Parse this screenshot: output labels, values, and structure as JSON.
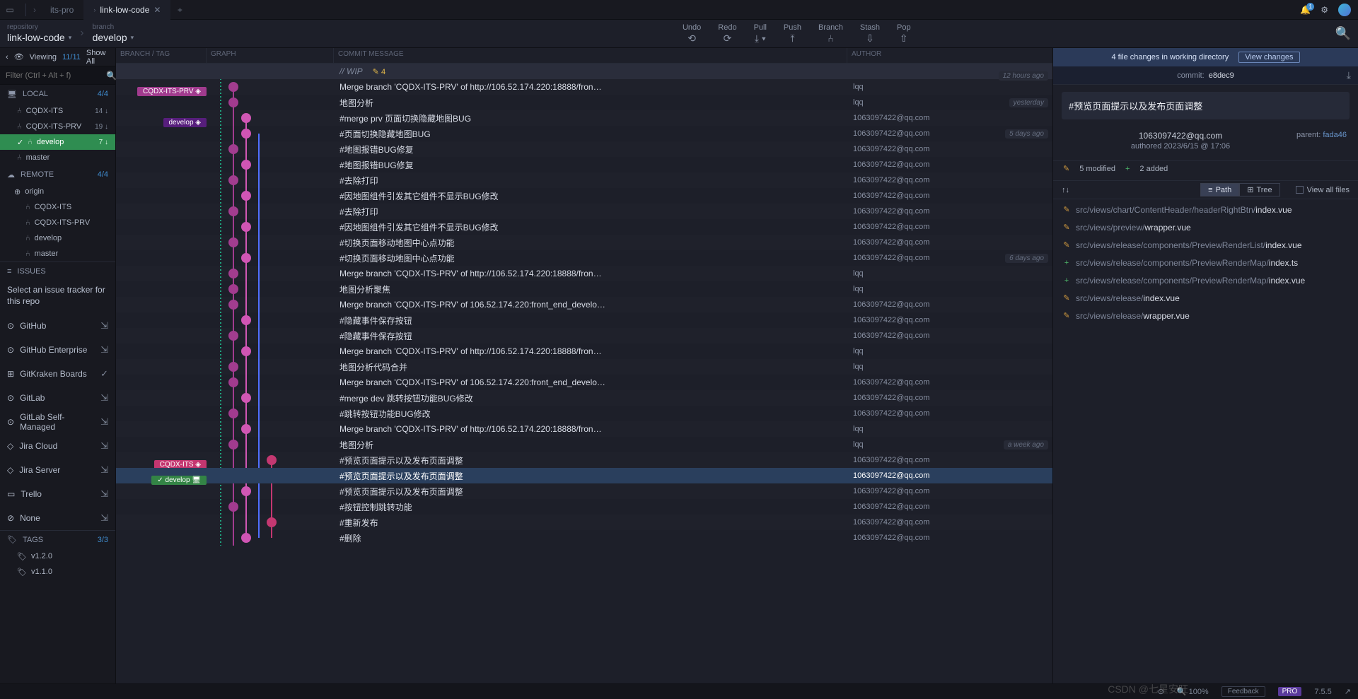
{
  "tabs": {
    "project": "its-pro",
    "active": "link-low-code"
  },
  "toolbar": {
    "repository_label": "repository",
    "repository": "link-low-code",
    "branch_label": "branch",
    "branch": "develop",
    "actions": {
      "undo": "Undo",
      "redo": "Redo",
      "pull": "Pull",
      "push": "Push",
      "branch": "Branch",
      "stash": "Stash",
      "pop": "Pop"
    }
  },
  "sidebar": {
    "viewing_label": "Viewing",
    "viewing_count": "11/11",
    "show_all": "Show All",
    "filter_placeholder": "Filter (Ctrl + Alt + f)",
    "local_label": "LOCAL",
    "local_count": "4/4",
    "local_branches": [
      {
        "name": "CQDX-ITS",
        "count": "14 ↓"
      },
      {
        "name": "CQDX-ITS-PRV",
        "count": "19 ↓"
      },
      {
        "name": "develop",
        "count": "7 ↓",
        "active": true
      },
      {
        "name": "master",
        "count": ""
      }
    ],
    "remote_label": "REMOTE",
    "remote_count": "4/4",
    "remote_origin": "origin",
    "remote_branches": [
      "CQDX-ITS",
      "CQDX-ITS-PRV",
      "develop",
      "master"
    ],
    "issues_label": "ISSUES",
    "issues_prompt": "Select an issue tracker for this repo",
    "trackers": [
      {
        "name": "GitHub",
        "icon": "⊙"
      },
      {
        "name": "GitHub Enterprise",
        "icon": "⊙"
      },
      {
        "name": "GitKraken Boards",
        "icon": "⊞",
        "check": true
      },
      {
        "name": "GitLab",
        "icon": "⊙"
      },
      {
        "name": "GitLab Self-Managed",
        "icon": "⊙"
      },
      {
        "name": "Jira Cloud",
        "icon": "◇"
      },
      {
        "name": "Jira Server",
        "icon": "◇"
      },
      {
        "name": "Trello",
        "icon": "▭"
      },
      {
        "name": "None",
        "icon": "⊘"
      }
    ],
    "tags_label": "TAGS",
    "tags_count": "3/3",
    "tags": [
      "v1.2.0",
      "v1.1.0"
    ]
  },
  "graph_header": {
    "branch": "BRANCH  /  TAG",
    "graph": "GRAPH",
    "msg": "COMMIT MESSAGE",
    "auth": "AUTHOR"
  },
  "wip": {
    "label": "// WIP",
    "count": "4"
  },
  "branch_tags": [
    {
      "row": 1,
      "text": "CQDX-ITS-PRV",
      "bg": "#a13b8e",
      "icon": "◈"
    },
    {
      "row": 3,
      "text": "develop",
      "bg": "#571e7c",
      "icon": "◈"
    },
    {
      "row": 25,
      "text": "CQDX-ITS",
      "bg": "#c43670",
      "icon": "◈"
    },
    {
      "row": 26,
      "text": "develop",
      "bg": "#338445",
      "icon": "🖥",
      "check": true
    }
  ],
  "time_badges": [
    {
      "row": 0,
      "text": "12 hours ago"
    },
    {
      "row": 2,
      "text": "yesterday"
    },
    {
      "row": 4,
      "text": "5 days ago"
    },
    {
      "row": 12,
      "text": "6 days ago"
    },
    {
      "row": 24,
      "text": "a week ago"
    }
  ],
  "commits": [
    {
      "msg": "Merge branch 'CQDX-ITS-PRV' of http://106.52.174.220:18888/fron…",
      "auth": "lqq"
    },
    {
      "msg": "地图分析",
      "auth": "lqq"
    },
    {
      "msg": "#merge prv 页面切换隐藏地图BUG",
      "auth": "1063097422@qq.com"
    },
    {
      "msg": "#页面切换隐藏地图BUG",
      "auth": "1063097422@qq.com"
    },
    {
      "msg": "#地图报错BUG修复",
      "auth": "1063097422@qq.com"
    },
    {
      "msg": "#地图报错BUG修复",
      "auth": "1063097422@qq.com"
    },
    {
      "msg": "#去除打印",
      "auth": "1063097422@qq.com"
    },
    {
      "msg": "#因地图组件引发其它组件不显示BUG修改",
      "auth": "1063097422@qq.com"
    },
    {
      "msg": "#去除打印",
      "auth": "1063097422@qq.com"
    },
    {
      "msg": "#因地图组件引发其它组件不显示BUG修改",
      "auth": "1063097422@qq.com"
    },
    {
      "msg": "#切换页面移动地图中心点功能",
      "auth": "1063097422@qq.com"
    },
    {
      "msg": "#切换页面移动地图中心点功能",
      "auth": "1063097422@qq.com"
    },
    {
      "msg": "Merge branch 'CQDX-ITS-PRV' of http://106.52.174.220:18888/fron…",
      "auth": "lqq"
    },
    {
      "msg": "地图分析聚焦",
      "auth": "lqq"
    },
    {
      "msg": "Merge branch 'CQDX-ITS-PRV' of 106.52.174.220:front_end_develo…",
      "auth": "1063097422@qq.com"
    },
    {
      "msg": "#隐藏事件保存按钮",
      "auth": "1063097422@qq.com"
    },
    {
      "msg": "#隐藏事件保存按钮",
      "auth": "1063097422@qq.com"
    },
    {
      "msg": "Merge branch 'CQDX-ITS-PRV' of http://106.52.174.220:18888/fron…",
      "auth": "lqq"
    },
    {
      "msg": "地图分析代码合并",
      "auth": "lqq"
    },
    {
      "msg": "Merge branch 'CQDX-ITS-PRV' of 106.52.174.220:front_end_develo…",
      "auth": "1063097422@qq.com"
    },
    {
      "msg": "#merge dev 跳转按钮功能BUG修改",
      "auth": "1063097422@qq.com"
    },
    {
      "msg": "#跳转按钮功能BUG修改",
      "auth": "1063097422@qq.com"
    },
    {
      "msg": "Merge branch 'CQDX-ITS-PRV' of http://106.52.174.220:18888/fron…",
      "auth": "lqq"
    },
    {
      "msg": "地图分析",
      "auth": "lqq"
    },
    {
      "msg": "#预览页面提示以及发布页面调整",
      "auth": "1063097422@qq.com"
    },
    {
      "msg": "#预览页面提示以及发布页面调整",
      "auth": "1063097422@qq.com",
      "selected": true
    },
    {
      "msg": "#预览页面提示以及发布页面调整",
      "auth": "1063097422@qq.com"
    },
    {
      "msg": "#按钮控制跳转功能",
      "auth": "1063097422@qq.com"
    },
    {
      "msg": "#重新发布",
      "auth": "1063097422@qq.com"
    },
    {
      "msg": "#删除",
      "auth": "1063097422@qq.com"
    }
  ],
  "details": {
    "top_msg": "4 file changes in working directory",
    "view_changes": "View changes",
    "commit_label": "commit:",
    "sha": "e8dec9",
    "title": "#预览页面提示以及发布页面调整",
    "author_email": "1063097422@qq.com",
    "authored_line": "authored  2023/6/15 @ 17:06",
    "parent_label": "parent:",
    "parent_sha": "fada46",
    "modified_count": "5 modified",
    "added_count": "2 added",
    "path_label": "Path",
    "tree_label": "Tree",
    "view_all": "View all files",
    "files": [
      {
        "stat": "mod",
        "dir": "src/views/chart/ContentHeader/headerRightBtn/",
        "name": "index.vue"
      },
      {
        "stat": "mod",
        "dir": "src/views/preview/",
        "name": "wrapper.vue"
      },
      {
        "stat": "mod",
        "dir": "src/views/release/components/PreviewRenderList/",
        "name": "index.vue"
      },
      {
        "stat": "add",
        "dir": "src/views/release/components/PreviewRenderMap/",
        "name": "index.ts"
      },
      {
        "stat": "add",
        "dir": "src/views/release/components/PreviewRenderMap/",
        "name": "index.vue"
      },
      {
        "stat": "mod",
        "dir": "src/views/release/",
        "name": "index.vue"
      },
      {
        "stat": "mod",
        "dir": "src/views/release/",
        "name": "wrapper.vue"
      }
    ]
  },
  "status": {
    "zoom": "100%",
    "feedback": "Feedback",
    "pro": "PRO",
    "version": "7.5.5"
  },
  "watermark": "CSDN @七星安旺"
}
